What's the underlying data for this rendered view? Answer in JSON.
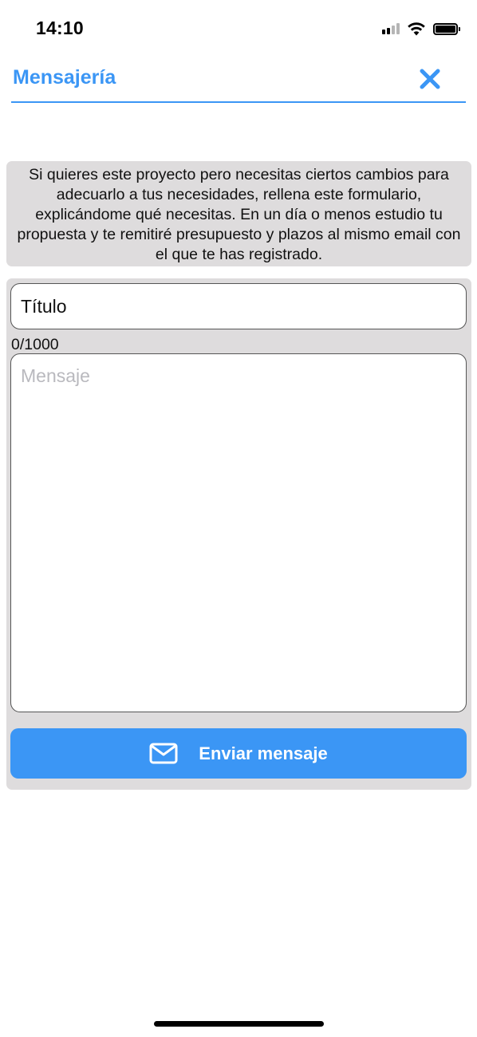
{
  "status_bar": {
    "time": "14:10",
    "icons": [
      "signal-icon",
      "wifi-icon",
      "battery-icon"
    ]
  },
  "header": {
    "title": "Mensajería",
    "close_icon": "close-icon"
  },
  "info": {
    "text": "Si quieres este proyecto pero necesitas ciertos cambios para adecuarlo a tus necesidades, rellena este formulario, explicándome qué necesitas. En un día o menos estudio tu propuesta y te remitiré presupuesto y plazos al mismo email con el que te has registrado."
  },
  "form": {
    "title_placeholder": "Título",
    "title_value": "",
    "counter": "0/1000",
    "message_placeholder": "Mensaje",
    "message_value": "",
    "send_label": "Enviar mensaje",
    "send_icon": "envelope-icon"
  },
  "colors": {
    "accent": "#3b96f5",
    "panel": "#dedcdd",
    "placeholder": "#b9b9be"
  }
}
